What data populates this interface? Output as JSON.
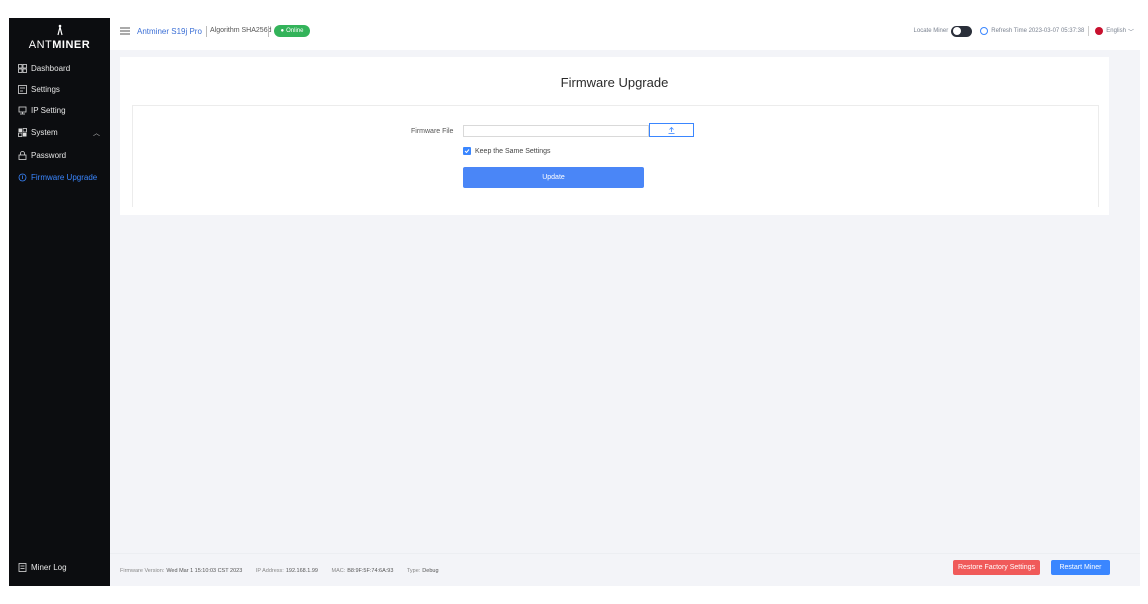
{
  "brand": {
    "logo_pre": "ANT",
    "logo_post": "MINER"
  },
  "sidebar": {
    "items": [
      {
        "label": "Dashboard",
        "icon": "dashboard-icon"
      },
      {
        "label": "Settings",
        "icon": "settings-icon"
      },
      {
        "label": "IP Setting",
        "icon": "ip-icon"
      },
      {
        "label": "System",
        "icon": "system-icon"
      },
      {
        "label": "Password",
        "icon": "password-icon"
      },
      {
        "label": "Firmware Upgrade",
        "icon": "firmware-icon",
        "active": true
      }
    ],
    "miner_log": "Miner Log"
  },
  "topbar": {
    "model": "Antminer S19j Pro",
    "algorithm": "Algorithm SHA256d",
    "status": "Online",
    "locate_miner": "Locate Miner",
    "refresh_time": "Refresh Time 2023-03-07 05:37:38",
    "language": "English"
  },
  "firmware": {
    "title": "Firmware Upgrade",
    "file_label": "Firmware File",
    "file_value": "",
    "keep_settings": "Keep the Same Settings",
    "update_label": "Update"
  },
  "footer": {
    "fw_version_label": "Firmware Version:",
    "fw_version": "Wed Mar 1 15:10:03 CST 2023",
    "ip_label": "IP Address:",
    "ip": "192.168.1.99",
    "mac_label": "MAC:",
    "mac": "B8:9F:5F:74:6A:93",
    "type_label": "Type:",
    "type": "Debug",
    "restore_label": "Restore Factory Settings",
    "restart_label": "Restart Miner"
  },
  "colors": {
    "accent": "#3a86ff",
    "danger": "#f05a5a",
    "online": "#33b35a",
    "sidebar": "#0c0d10"
  }
}
